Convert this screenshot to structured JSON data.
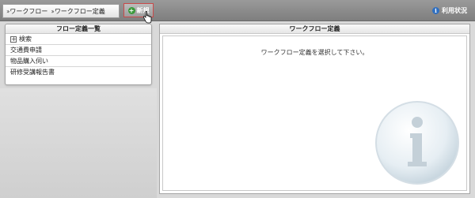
{
  "breadcrumb": [
    {
      "label": "ワークフロー"
    },
    {
      "label": "ワークフロー定義"
    }
  ],
  "toolbar": {
    "new_label": "新規",
    "usage_label": "利用状況",
    "usage_icon": "info-icon"
  },
  "left_panel": {
    "title": "フロー定義一覧",
    "search_label": "検索",
    "items": [
      {
        "label": "交通費申請"
      },
      {
        "label": "物品購入伺い"
      },
      {
        "label": "研修受講報告書"
      }
    ]
  },
  "right_panel": {
    "title": "ワークフロー定義",
    "message": "ワークフロー定義を選択して下さい。"
  },
  "colors": {
    "topbar": "#8a8a8a",
    "new_button_border": "#c94a4a",
    "info_blue": "#2f6fc0"
  }
}
